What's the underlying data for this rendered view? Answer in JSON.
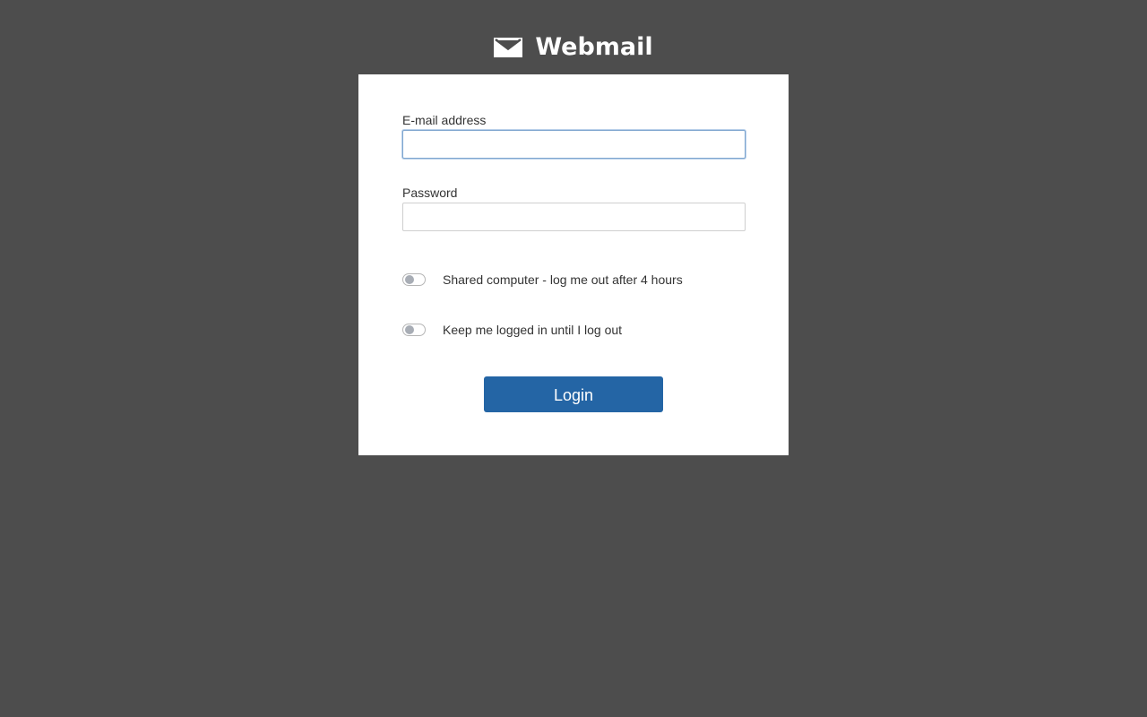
{
  "header": {
    "logo_icon": "envelope-icon",
    "title": "Webmail"
  },
  "form": {
    "email": {
      "label": "E-mail address",
      "value": "",
      "placeholder": ""
    },
    "password": {
      "label": "Password",
      "value": "",
      "placeholder": ""
    },
    "shared_computer": {
      "label": "Shared computer - log me out after 4 hours",
      "checked": false
    },
    "keep_logged_in": {
      "label": "Keep me logged in until I log out",
      "checked": false
    },
    "login_label": "Login"
  },
  "colors": {
    "background": "#4d4d4d",
    "card": "#ffffff",
    "accent": "#2465a5",
    "text": "#333333"
  }
}
